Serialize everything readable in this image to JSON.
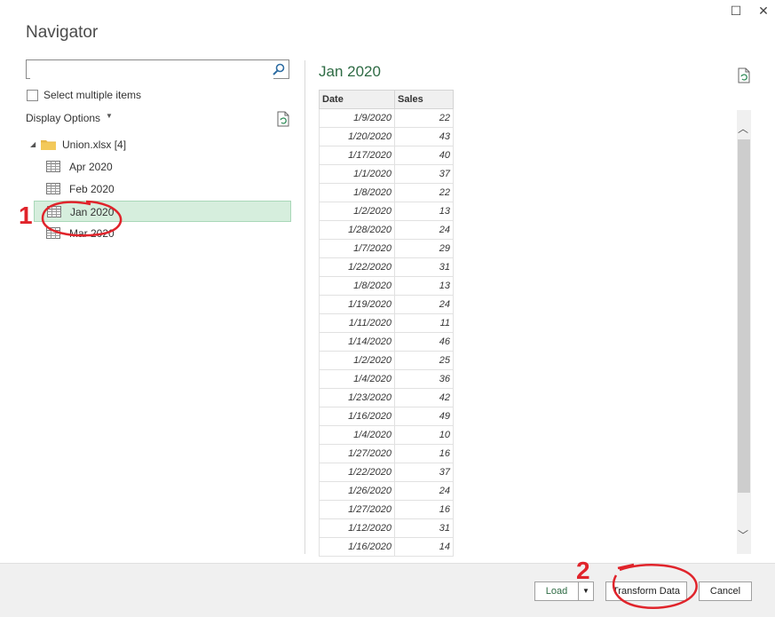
{
  "window": {
    "title": "Navigator",
    "maximize_glyph": "☐",
    "close_glyph": "✕"
  },
  "search": {
    "value": "",
    "placeholder": ""
  },
  "select_multiple": {
    "label": "Select multiple items",
    "checked": false
  },
  "display_options": {
    "label": "Display Options",
    "caret": "▼"
  },
  "tree": {
    "arrow": "◢",
    "root_label": "Union.xlsx [4]",
    "items": [
      {
        "label": "Apr 2020"
      },
      {
        "label": "Feb 2020"
      },
      {
        "label": "Jan 2020",
        "selected": true
      },
      {
        "label": "Mar 2020"
      }
    ]
  },
  "preview": {
    "title": "Jan 2020",
    "columns": [
      "Date",
      "Sales"
    ],
    "rows": [
      [
        "1/9/2020",
        "22"
      ],
      [
        "1/20/2020",
        "43"
      ],
      [
        "1/17/2020",
        "40"
      ],
      [
        "1/1/2020",
        "37"
      ],
      [
        "1/8/2020",
        "22"
      ],
      [
        "1/2/2020",
        "13"
      ],
      [
        "1/28/2020",
        "24"
      ],
      [
        "1/7/2020",
        "29"
      ],
      [
        "1/22/2020",
        "31"
      ],
      [
        "1/8/2020",
        "13"
      ],
      [
        "1/19/2020",
        "24"
      ],
      [
        "1/11/2020",
        "11"
      ],
      [
        "1/14/2020",
        "46"
      ],
      [
        "1/2/2020",
        "25"
      ],
      [
        "1/4/2020",
        "36"
      ],
      [
        "1/23/2020",
        "42"
      ],
      [
        "1/16/2020",
        "49"
      ],
      [
        "1/4/2020",
        "10"
      ],
      [
        "1/27/2020",
        "16"
      ],
      [
        "1/22/2020",
        "37"
      ],
      [
        "1/26/2020",
        "24"
      ],
      [
        "1/27/2020",
        "16"
      ],
      [
        "1/12/2020",
        "31"
      ],
      [
        "1/16/2020",
        "14"
      ]
    ]
  },
  "scrollbar": {
    "up_glyph": "︿",
    "down_glyph": "﹀"
  },
  "footer": {
    "load_label": "Load",
    "load_dropdown_glyph": "▼",
    "transform_label": "Transform Data",
    "cancel_label": "Cancel"
  },
  "annotations": {
    "step1": "1",
    "step2": "2",
    "color": "#e0242b"
  }
}
